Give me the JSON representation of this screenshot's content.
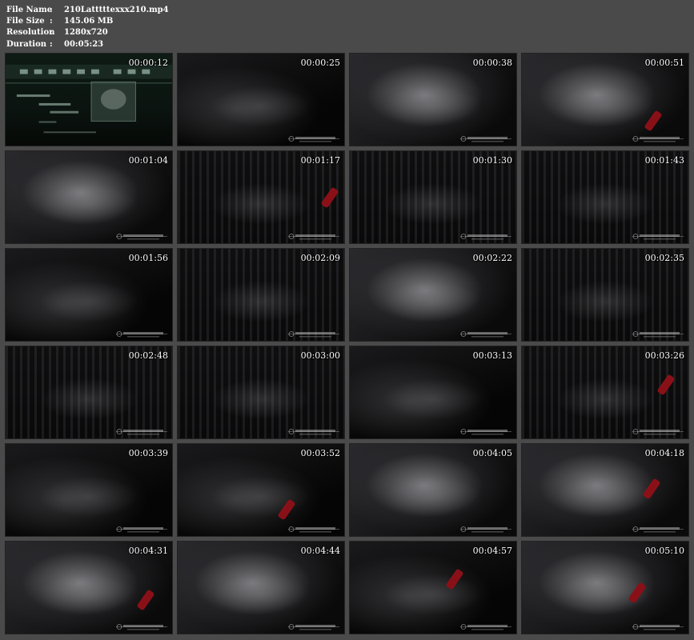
{
  "file_info": {
    "file_name_label": "File Name",
    "file_name": "210Latttttexxx210.mp4",
    "file_size_label": "File Size",
    "file_size": "145.06 MB",
    "resolution_label": "Resolution",
    "resolution": "1280x720",
    "duration_label": "Duration",
    "duration": "00:05:23",
    "separator": ":"
  },
  "thumbnails": [
    {
      "time": "00:00:12",
      "style": "title-card"
    },
    {
      "time": "00:00:25",
      "style": "dark"
    },
    {
      "time": "00:00:38",
      "style": "bag"
    },
    {
      "time": "00:00:51",
      "style": "bag"
    },
    {
      "time": "00:01:04",
      "style": "bag"
    },
    {
      "time": "00:01:17",
      "style": "room"
    },
    {
      "time": "00:01:30",
      "style": "room"
    },
    {
      "time": "00:01:43",
      "style": "room"
    },
    {
      "time": "00:01:56",
      "style": "dark"
    },
    {
      "time": "00:02:09",
      "style": "room"
    },
    {
      "time": "00:02:22",
      "style": "bag"
    },
    {
      "time": "00:02:35",
      "style": "room"
    },
    {
      "time": "00:02:48",
      "style": "room"
    },
    {
      "time": "00:03:00",
      "style": "room"
    },
    {
      "time": "00:03:13",
      "style": "dark"
    },
    {
      "time": "00:03:26",
      "style": "room"
    },
    {
      "time": "00:03:39",
      "style": "dark"
    },
    {
      "time": "00:03:52",
      "style": "dark"
    },
    {
      "time": "00:04:05",
      "style": "bag"
    },
    {
      "time": "00:04:18",
      "style": "bag"
    },
    {
      "time": "00:04:31",
      "style": "bag"
    },
    {
      "time": "00:04:44",
      "style": "bag"
    },
    {
      "time": "00:04:57",
      "style": "dark"
    },
    {
      "time": "00:05:10",
      "style": "bag"
    }
  ],
  "colors": {
    "background": "#4a4a4a",
    "text": "#ffffff",
    "accent_red": "#8a1018"
  }
}
